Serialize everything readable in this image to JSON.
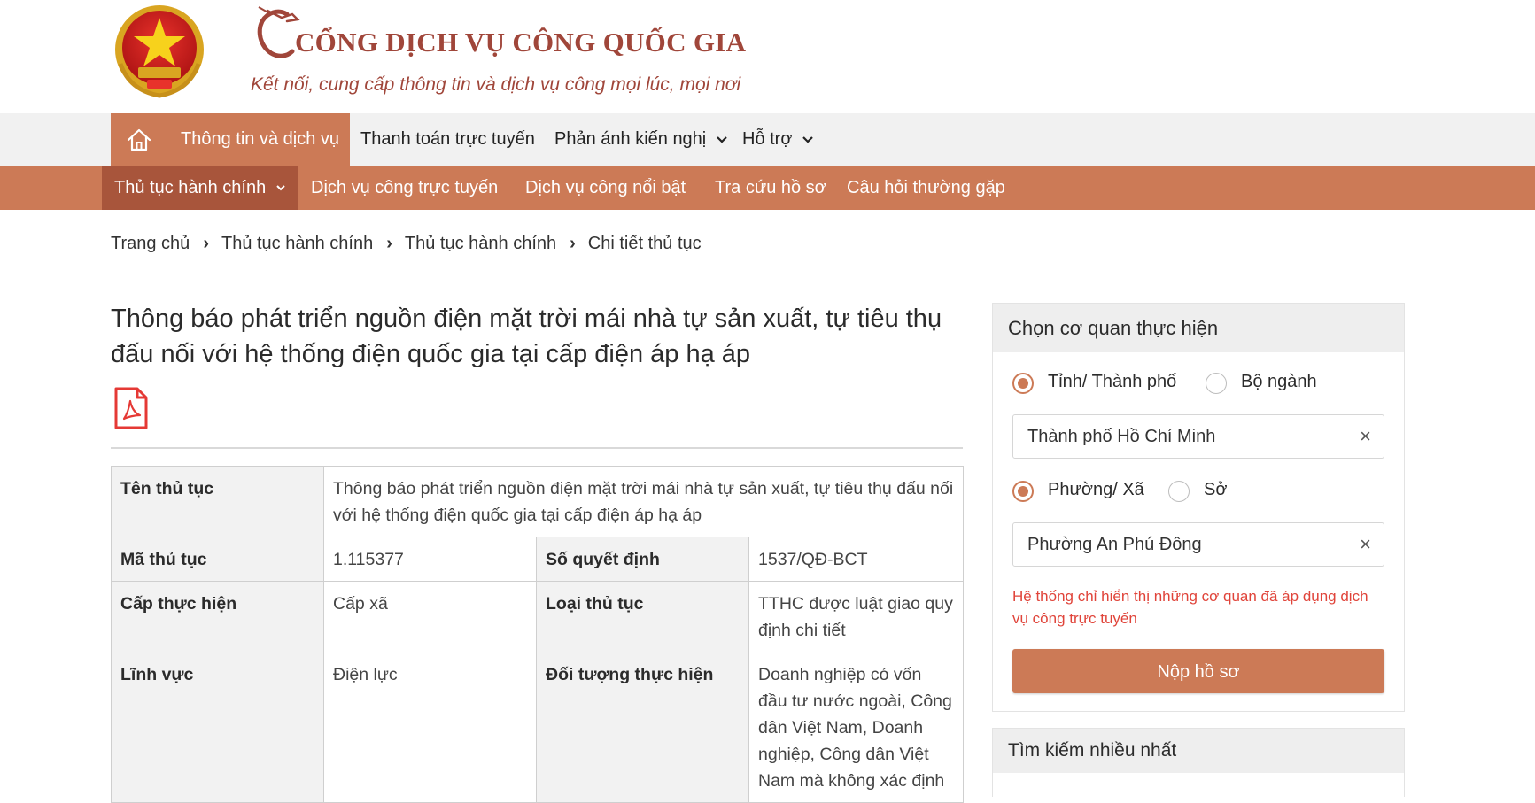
{
  "header": {
    "title": "CỔNG DỊCH VỤ CÔNG QUỐC GIA",
    "slogan": "Kết nối, cung cấp thông tin và dịch vụ công mọi lúc, mọi nơi",
    "brand_color": "#a0463a"
  },
  "topnav": {
    "home_icon": "home-icon",
    "items": [
      {
        "label": "Thông tin và dịch vụ",
        "active": true
      },
      {
        "label": "Thanh toán trực tuyến"
      },
      {
        "label": "Phản ánh kiến nghị",
        "has_dropdown": true
      },
      {
        "label": "Hỗ trợ",
        "has_dropdown": true
      }
    ],
    "accent": "#cc7a56"
  },
  "subnav": {
    "items": [
      {
        "label": "Thủ tục hành chính",
        "active": true,
        "has_dropdown": true
      },
      {
        "label": "Dịch vụ công trực tuyến"
      },
      {
        "label": "Dịch vụ công nổi bật"
      },
      {
        "label": "Tra cứu hồ sơ"
      },
      {
        "label": "Câu hỏi thường gặp"
      }
    ]
  },
  "breadcrumb": [
    "Trang chủ",
    "Thủ tục hành chính",
    "Thủ tục hành chính",
    "Chi tiết thủ tục"
  ],
  "main": {
    "title": "Thông báo phát triển nguồn điện mặt trời mái nhà tự sản xuất, tự tiêu thụ đấu nối với hệ thống điện quốc gia tại cấp điện áp hạ áp",
    "pdf_icon": "pdf-file-icon",
    "table": {
      "ten_thu_tuc_label": "Tên thủ tục",
      "ten_thu_tuc_value": "Thông báo phát triển nguồn điện mặt trời mái nhà tự sản xuất, tự tiêu thụ đấu nối với hệ thống điện quốc gia tại cấp điện áp hạ áp",
      "ma_thu_tuc_label": "Mã thủ tục",
      "ma_thu_tuc_value": "1.115377",
      "so_quyet_dinh_label": "Số quyết định",
      "so_quyet_dinh_value": "1537/QĐ-BCT",
      "cap_thuc_hien_label": "Cấp thực hiện",
      "cap_thuc_hien_value": "Cấp xã",
      "loai_thu_tuc_label": "Loại thủ tục",
      "loai_thu_tuc_value": "TTHC được luật giao quy định chi tiết",
      "linh_vuc_label": "Lĩnh vực",
      "linh_vuc_value": "Điện lực",
      "doi_tuong_label": "Đối tượng thực hiện",
      "doi_tuong_value": "Doanh nghiệp có vốn đầu tư nước ngoài, Công dân Việt Nam, Doanh nghiệp, Công dân Việt Nam mà không xác định"
    }
  },
  "sidebar": {
    "agency_panel": {
      "title": "Chọn cơ quan thực hiện",
      "level1_options": [
        {
          "label": "Tỉnh/ Thành phố",
          "selected": true
        },
        {
          "label": "Bộ ngành",
          "selected": false
        }
      ],
      "level1_value": "Thành phố Hồ Chí Minh",
      "level2_options": [
        {
          "label": "Phường/ Xã",
          "selected": true
        },
        {
          "label": "Sở",
          "selected": false
        }
      ],
      "level2_value": "Phường An Phú Đông",
      "clear_glyph": "×",
      "notice": "Hệ thống chỉ hiển thị những cơ quan đã áp dụng dịch vụ công trực tuyến",
      "notice_color": "#e0443a",
      "submit_label": "Nộp hồ sơ"
    },
    "popular_panel": {
      "title": "Tìm kiếm nhiều nhất"
    }
  }
}
